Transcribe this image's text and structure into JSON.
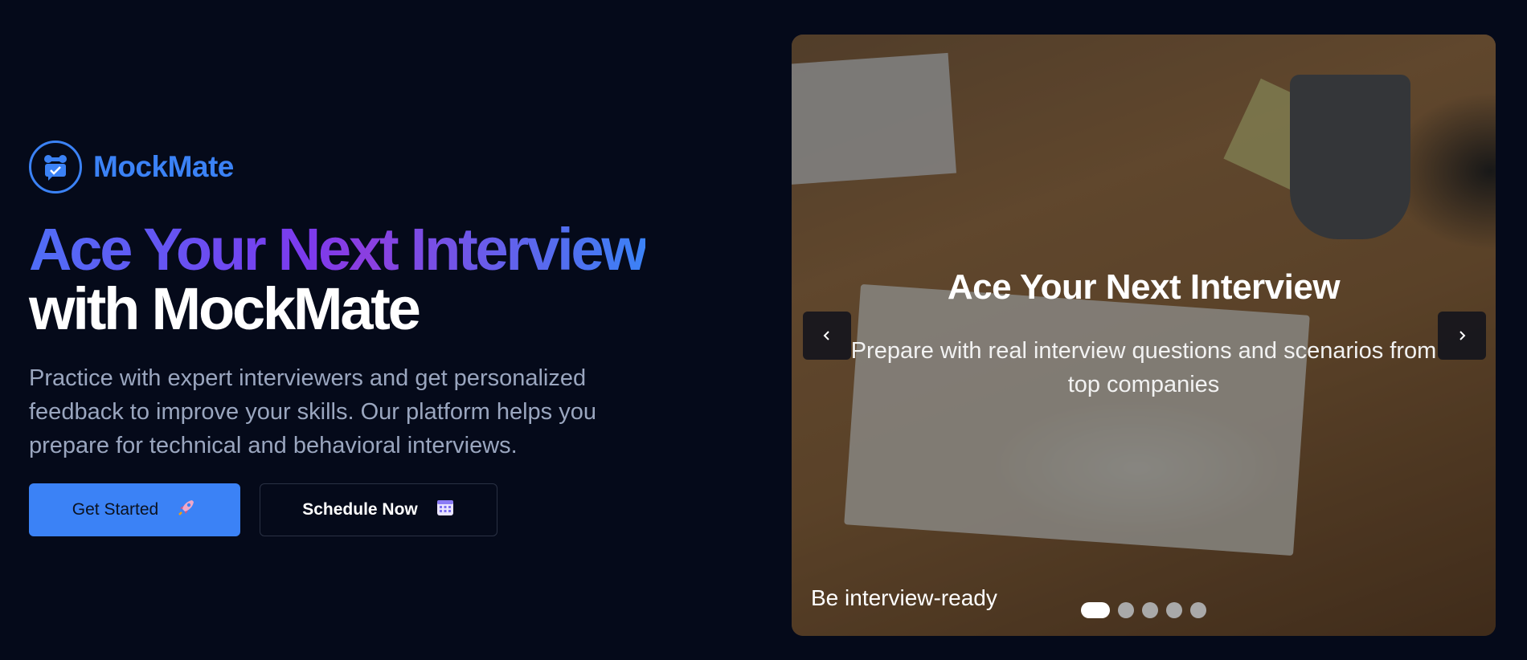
{
  "brand": {
    "name": "MockMate",
    "accent": "#3b82f6",
    "icon": "robot-chat-icon"
  },
  "hero": {
    "title_line1": "Ace Your Next Interview",
    "title_line2": "with MockMate",
    "description": "Practice with expert interviewers and get personalized feedback to improve your skills. Our platform helps you prepare for technical and behavioral interviews."
  },
  "actions": {
    "primary_label": "Get Started",
    "primary_icon": "rocket-icon",
    "secondary_label": "Schedule Now",
    "secondary_icon": "calendar-icon"
  },
  "carousel": {
    "slide_title": "Ace Your Next Interview",
    "slide_subtitle": "Prepare with real interview questions and scenarios from top companies",
    "caption": "Be interview-ready",
    "slide_count": 5,
    "active_slide": 1,
    "prev_icon": "chevron-left-icon",
    "next_icon": "chevron-right-icon"
  },
  "colors": {
    "background": "#050a1a",
    "text_muted": "#9aa6bf",
    "gradient_start": "#4f6ef7",
    "gradient_mid": "#7c3aed",
    "gradient_end": "#3b82f6"
  }
}
